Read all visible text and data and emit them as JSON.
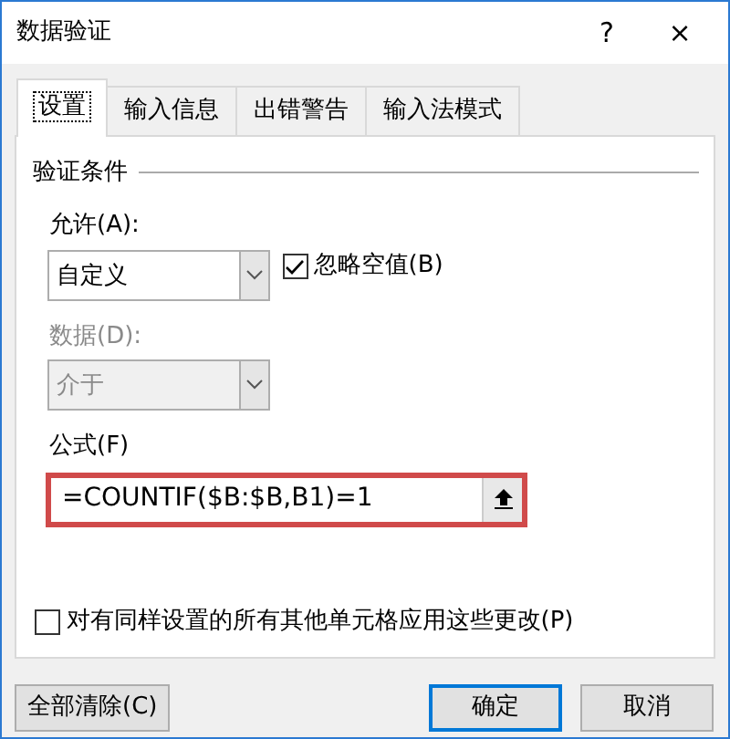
{
  "window": {
    "title": "数据验证",
    "help": "?",
    "close": "×"
  },
  "tabs": [
    {
      "label": "设置",
      "selected": true
    },
    {
      "label": "输入信息",
      "selected": false
    },
    {
      "label": "出错警告",
      "selected": false
    },
    {
      "label": "输入法模式",
      "selected": false
    }
  ],
  "group": {
    "title": "验证条件"
  },
  "allow": {
    "label": "允许(A):",
    "value": "自定义",
    "disabled": false
  },
  "ignore_blank": {
    "label": "忽略空值(B)",
    "checked": true
  },
  "data": {
    "label": "数据(D):",
    "value": "介于",
    "disabled": true
  },
  "formula": {
    "label": "公式(F)",
    "value": "=COUNTIF($B:$B,B1)=1",
    "highlighted": true
  },
  "apply_all": {
    "label": "对有同样设置的所有其他单元格应用这些更改(P)",
    "checked": false
  },
  "buttons": [
    {
      "label": "全部清除(C)",
      "default": false
    },
    {
      "label": "确定",
      "default": true
    },
    {
      "label": "取消",
      "default": false
    }
  ]
}
